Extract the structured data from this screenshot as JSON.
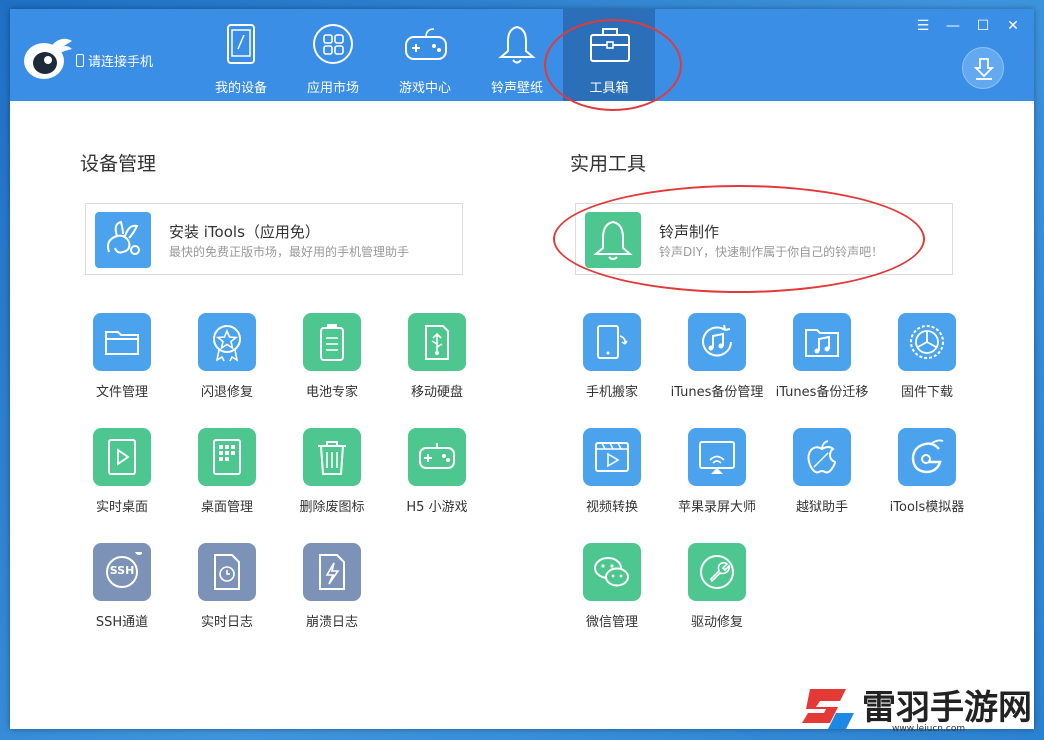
{
  "app": {
    "connect_label": "请连接手机"
  },
  "tabs": [
    {
      "label": "我的设备",
      "icon": "tablet-icon"
    },
    {
      "label": "应用市场",
      "icon": "apps-grid-icon"
    },
    {
      "label": "游戏中心",
      "icon": "gamepad-icon"
    },
    {
      "label": "铃声壁纸",
      "icon": "bell-icon"
    },
    {
      "label": "工具箱",
      "icon": "toolbox-icon",
      "active": true
    }
  ],
  "window_controls": [
    "menu-icon",
    "minimize-icon",
    "maximize-icon",
    "close-icon"
  ],
  "download_icon": "download-icon",
  "left_section": {
    "title": "设备管理",
    "card": {
      "title": "安装 iTools（应用免）",
      "desc": "最快的免费正版市场，最好用的手机管理助手",
      "icon": "rabbit-icon"
    },
    "tools": [
      {
        "label": "文件管理",
        "icon": "folder-icon",
        "color": "blue"
      },
      {
        "label": "闪退修复",
        "icon": "badge-star-icon",
        "color": "blue"
      },
      {
        "label": "电池专家",
        "icon": "battery-icon",
        "color": "green"
      },
      {
        "label": "移动硬盘",
        "icon": "usb-drive-icon",
        "color": "green"
      },
      {
        "label": "实时桌面",
        "icon": "play-screen-icon",
        "color": "green"
      },
      {
        "label": "桌面管理",
        "icon": "phone-grid-icon",
        "color": "green"
      },
      {
        "label": "删除废图标",
        "icon": "trash-icon",
        "color": "green"
      },
      {
        "label": "H5 小游戏",
        "icon": "gamepad-icon",
        "color": "green"
      },
      {
        "label": "SSH通道",
        "icon": "ssh-icon",
        "color": "slate",
        "icon_text": "SSH"
      },
      {
        "label": "实时日志",
        "icon": "clock-file-icon",
        "color": "slate"
      },
      {
        "label": "崩溃日志",
        "icon": "crash-file-icon",
        "color": "slate"
      }
    ]
  },
  "right_section": {
    "title": "实用工具",
    "card": {
      "title": "铃声制作",
      "desc": "铃声DIY，快速制作属于你自己的铃声吧！",
      "icon": "bell-icon"
    },
    "tools": [
      {
        "label": "手机搬家",
        "icon": "phone-sync-icon",
        "color": "blue"
      },
      {
        "label": "iTunes备份管理",
        "icon": "music-sync-icon",
        "color": "blue"
      },
      {
        "label": "iTunes备份迁移",
        "icon": "music-folder-icon",
        "color": "blue"
      },
      {
        "label": "固件下载",
        "icon": "firmware-icon",
        "color": "blue"
      },
      {
        "label": "视频转换",
        "icon": "video-icon",
        "color": "blue"
      },
      {
        "label": "苹果录屏大师",
        "icon": "airplay-icon",
        "color": "blue"
      },
      {
        "label": "越狱助手",
        "icon": "apple-icon",
        "color": "blue"
      },
      {
        "label": "iTools模拟器",
        "icon": "itools-g-icon",
        "color": "blue"
      },
      {
        "label": "微信管理",
        "icon": "wechat-icon",
        "color": "green"
      },
      {
        "label": "驱动修复",
        "icon": "wrench-icon",
        "color": "green"
      }
    ]
  },
  "watermark": {
    "text": "雷羽手游网",
    "url": "www.leiucn.com"
  },
  "colors": {
    "titlebar": "#3a8ee6",
    "active_tab": "#2b6fb9",
    "tool_blue": "#4aa3ec",
    "tool_green": "#4dc78f",
    "tool_slate": "#7d92b7",
    "highlight_ellipse": "#e23a3a"
  }
}
